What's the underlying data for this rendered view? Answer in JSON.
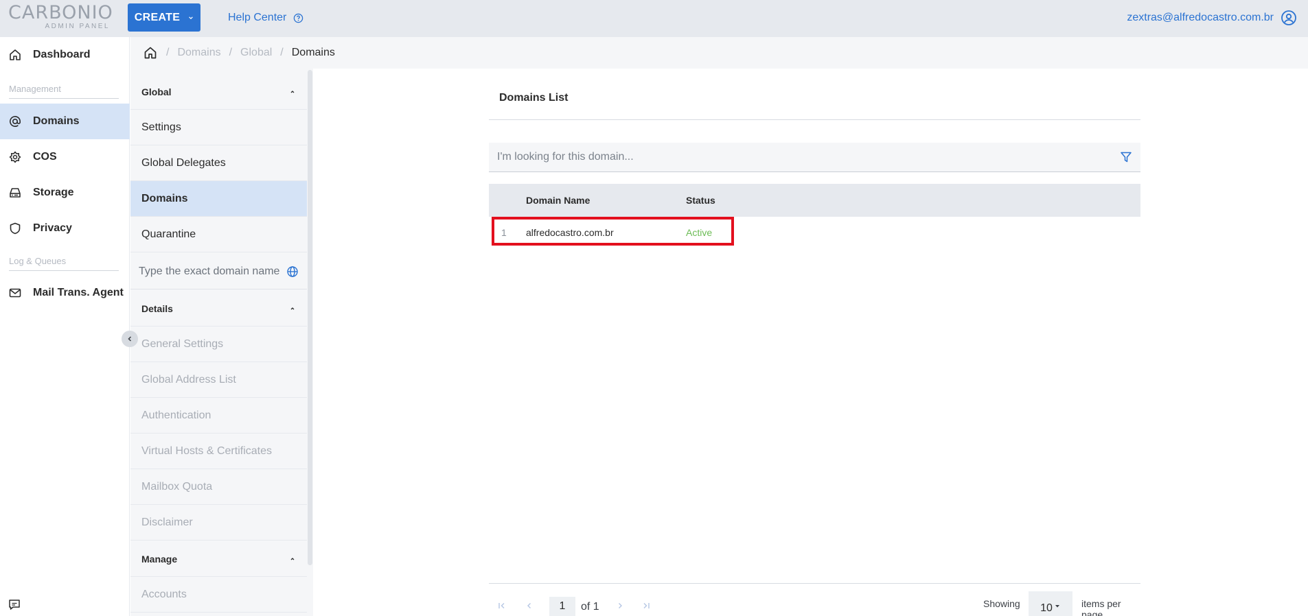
{
  "topbar": {
    "logo_main": "CARBONIO",
    "logo_sub": "ADMIN PANEL",
    "create_label": "CREATE",
    "help_label": "Help Center",
    "user_email": "zextras@alfredocastro.com.br"
  },
  "leftnav": {
    "dashboard": "Dashboard",
    "section_management": "Management",
    "items": [
      {
        "label": "Domains",
        "icon": "at-icon"
      },
      {
        "label": "COS",
        "icon": "cos-icon"
      },
      {
        "label": "Storage",
        "icon": "storage-icon"
      },
      {
        "label": "Privacy",
        "icon": "shield-icon"
      }
    ],
    "section_logs": "Log & Queues",
    "mta": "Mail Trans. Agent"
  },
  "breadcrumb": {
    "items": [
      "Domains",
      "Global",
      "Domains"
    ]
  },
  "midpanel": {
    "global_header": "Global",
    "global_items": [
      "Settings",
      "Global Delegates",
      "Domains",
      "Quarantine"
    ],
    "search_placeholder": "Type the exact domain name",
    "details_header": "Details",
    "details_items": [
      "General Settings",
      "Global Address List",
      "Authentication",
      "Virtual Hosts & Certificates",
      "Mailbox Quota",
      "Disclaimer"
    ],
    "manage_header": "Manage",
    "manage_items": [
      "Accounts"
    ]
  },
  "main": {
    "title": "Domains List",
    "search_placeholder": "I'm looking for this domain...",
    "columns": [
      "Domain Name",
      "Status"
    ],
    "rows": [
      {
        "index": "1",
        "domain": "alfredocastro.com.br",
        "status": "Active"
      }
    ],
    "pager": {
      "page": "1",
      "of": "of 1",
      "showing": "Showing",
      "per_page": "10",
      "items_per_page": "items per page"
    }
  },
  "colors": {
    "accent": "#2b73d2",
    "active_status": "#6cbc55",
    "highlight": "#e3101e",
    "selected_bg": "#d5e3f6"
  }
}
